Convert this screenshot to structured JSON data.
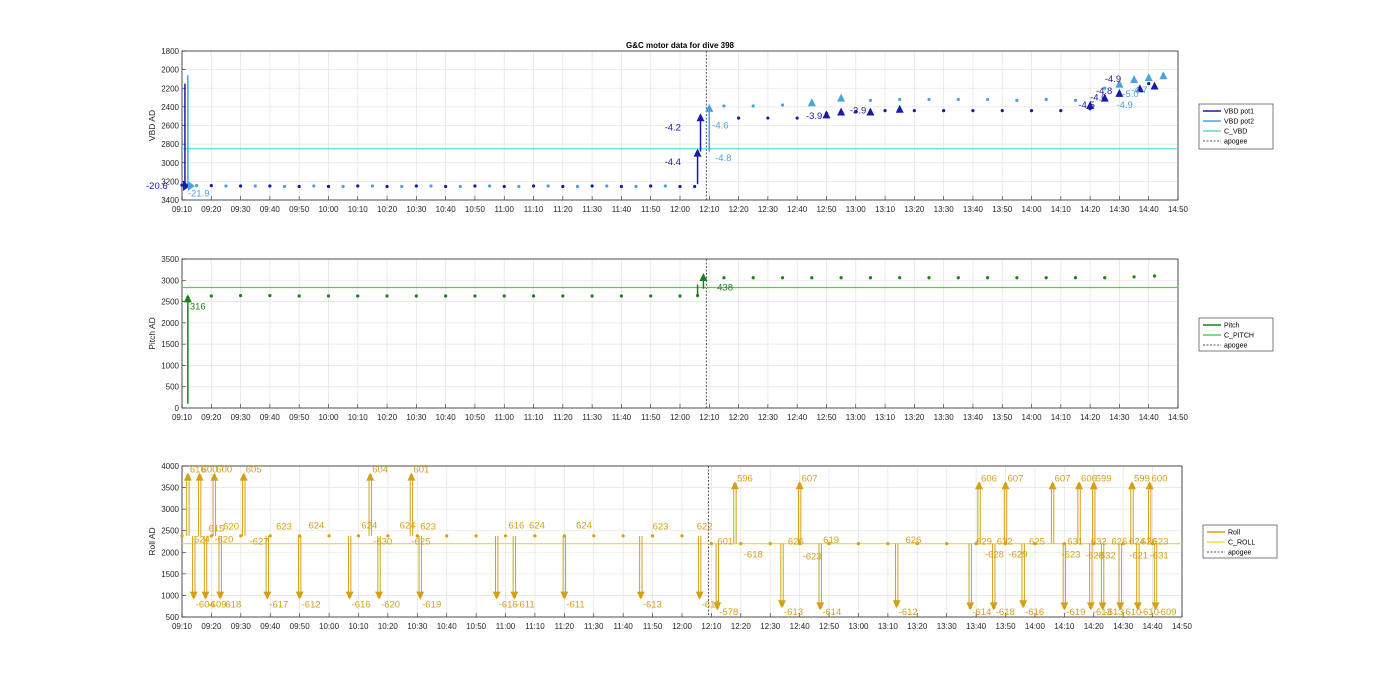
{
  "chart_data": [
    {
      "type": "scatter",
      "title": "G&C motor data for dive 398",
      "ylabel": "VBD AD",
      "ylim": [
        3400,
        1800
      ],
      "y_reversed": true,
      "yticks": [
        1800,
        2000,
        2200,
        2400,
        2600,
        2800,
        3000,
        3200,
        3400
      ],
      "xlim": [
        "09:10",
        "14:50"
      ],
      "xticks": [
        "09:10",
        "09:20",
        "09:30",
        "09:40",
        "09:50",
        "10:00",
        "10:10",
        "10:20",
        "10:30",
        "10:40",
        "10:50",
        "11:00",
        "11:10",
        "11:20",
        "11:30",
        "11:40",
        "11:50",
        "12:00",
        "12:10",
        "12:20",
        "12:30",
        "12:40",
        "12:50",
        "13:00",
        "13:10",
        "13:20",
        "13:30",
        "13:40",
        "13:50",
        "14:00",
        "14:10",
        "14:20",
        "14:30",
        "14:40",
        "14:50"
      ],
      "grid": true,
      "legend": {
        "position": "right",
        "entries": [
          "VBD pot1",
          "VBD pot2",
          "C_VBD",
          "apogee"
        ]
      },
      "colors": {
        "VBD pot1": "#1a1aa6",
        "VBD pot2": "#4aa3df",
        "C_VBD": "#5fd7e0",
        "apogee": "#555555"
      },
      "c_vbd": 2850,
      "apogee": "12:09",
      "series": [
        {
          "name": "VBD pot1",
          "x": [
            "09:10",
            "09:20",
            "09:30",
            "09:40",
            "09:50",
            "10:00",
            "10:10",
            "10:20",
            "10:30",
            "10:40",
            "10:50",
            "11:00",
            "11:10",
            "11:20",
            "11:30",
            "11:40",
            "11:50",
            "12:00",
            "12:05",
            "12:20",
            "12:30",
            "12:40",
            "12:50",
            "13:00",
            "13:10",
            "13:20",
            "13:30",
            "13:40",
            "13:50",
            "14:00",
            "14:10",
            "14:20",
            "14:30",
            "14:40"
          ],
          "y": [
            3240,
            3245,
            3250,
            3250,
            3255,
            3255,
            3250,
            3255,
            3250,
            3255,
            3250,
            3255,
            3250,
            3255,
            3250,
            3255,
            3250,
            3255,
            3255,
            2520,
            2520,
            2520,
            2470,
            2450,
            2440,
            2440,
            2440,
            2440,
            2440,
            2440,
            2440,
            2420,
            2250,
            2150
          ]
        },
        {
          "name": "VBD pot2",
          "x": [
            "09:15",
            "09:25",
            "09:35",
            "09:45",
            "09:55",
            "10:05",
            "10:15",
            "10:25",
            "10:35",
            "10:45",
            "10:55",
            "11:05",
            "11:15",
            "11:25",
            "11:35",
            "11:45",
            "11:55",
            "12:15",
            "12:25",
            "12:35",
            "12:45",
            "12:55",
            "13:05",
            "13:15",
            "13:25",
            "13:35",
            "13:45",
            "13:55",
            "14:05",
            "14:15",
            "14:25",
            "14:35",
            "14:45"
          ],
          "y": [
            3245,
            3250,
            3250,
            3255,
            3250,
            3255,
            3250,
            3255,
            3250,
            3255,
            3250,
            3255,
            3250,
            3255,
            3250,
            3255,
            3250,
            2390,
            2390,
            2380,
            2350,
            2320,
            2330,
            2320,
            2320,
            2320,
            2320,
            2330,
            2320,
            2330,
            2200,
            2100,
            2060
          ]
        }
      ],
      "annotations": [
        {
          "x": "09:10",
          "y": 3250,
          "text": "-20.6"
        },
        {
          "x": "09:12",
          "y": 3330,
          "text": "-21.9"
        },
        {
          "x": "12:06",
          "y": 2990,
          "text": "-4.4"
        },
        {
          "x": "12:06",
          "y": 2620,
          "text": "-4.2"
        },
        {
          "x": "12:11",
          "y": 2600,
          "text": "-4.6"
        },
        {
          "x": "12:12",
          "y": 2950,
          "text": "-4.8"
        },
        {
          "x": "12:43",
          "y": 2500,
          "text": "-3.9"
        },
        {
          "x": "12:58",
          "y": 2440,
          "text": "-3.9"
        },
        {
          "x": "14:16",
          "y": 2380,
          "text": "-4.5"
        },
        {
          "x": "14:20",
          "y": 2300,
          "text": "-4.0"
        },
        {
          "x": "14:22",
          "y": 2230,
          "text": "-4.8"
        },
        {
          "x": "14:25",
          "y": 2100,
          "text": "-4.9"
        },
        {
          "x": "14:29",
          "y": 2380,
          "text": "-4.9"
        },
        {
          "x": "14:31",
          "y": 2260,
          "text": "-5.0"
        },
        {
          "x": "14:34",
          "y": 2220,
          "text": "-4.7"
        }
      ]
    },
    {
      "type": "scatter",
      "ylabel": "Pitch AD",
      "ylim": [
        0,
        3500
      ],
      "yticks": [
        0,
        500,
        1000,
        1500,
        2000,
        2500,
        3000,
        3500
      ],
      "xlim": [
        "09:10",
        "14:50"
      ],
      "xticks": [
        "09:10",
        "09:20",
        "09:30",
        "09:40",
        "09:50",
        "10:00",
        "10:10",
        "10:20",
        "10:30",
        "10:40",
        "10:50",
        "11:00",
        "11:10",
        "11:20",
        "11:30",
        "11:40",
        "11:50",
        "12:00",
        "12:10",
        "12:20",
        "12:30",
        "12:40",
        "12:50",
        "13:00",
        "13:10",
        "13:20",
        "13:30",
        "13:40",
        "13:50",
        "14:00",
        "14:10",
        "14:20",
        "14:30",
        "14:40",
        "14:50"
      ],
      "grid": true,
      "legend": {
        "position": "right",
        "entries": [
          "Pitch",
          "C_PITCH",
          "apogee"
        ]
      },
      "colors": {
        "Pitch": "#1e7d1e",
        "C_PITCH": "#4dd24d",
        "apogee": "#555555"
      },
      "c_pitch": 2830,
      "apogee": "12:09",
      "series": [
        {
          "name": "Pitch",
          "x": [
            "09:12",
            "09:20",
            "09:30",
            "09:40",
            "09:50",
            "10:00",
            "10:10",
            "10:20",
            "10:30",
            "10:40",
            "10:50",
            "11:00",
            "11:10",
            "11:20",
            "11:30",
            "11:40",
            "11:50",
            "12:00",
            "12:06",
            "12:15",
            "12:25",
            "12:35",
            "12:45",
            "12:55",
            "13:05",
            "13:15",
            "13:25",
            "13:35",
            "13:45",
            "13:55",
            "14:05",
            "14:15",
            "14:25",
            "14:35",
            "14:42"
          ],
          "y": [
            2600,
            2630,
            2640,
            2640,
            2630,
            2630,
            2630,
            2630,
            2630,
            2630,
            2630,
            2630,
            2630,
            2630,
            2630,
            2630,
            2630,
            2630,
            2640,
            3060,
            3060,
            3060,
            3060,
            3060,
            3060,
            3060,
            3060,
            3060,
            3060,
            3060,
            3060,
            3060,
            3060,
            3080,
            3100
          ]
        }
      ],
      "annotations": [
        {
          "x": "09:12",
          "y": 2380,
          "text": "316"
        },
        {
          "x": "12:12",
          "y": 2830,
          "text": "438"
        }
      ]
    },
    {
      "type": "scatter",
      "ylabel": "Roll AD",
      "ylim": [
        500,
        4000
      ],
      "yticks": [
        500,
        1000,
        1500,
        2000,
        2500,
        3000,
        3500,
        4000
      ],
      "xlim": [
        "09:10",
        "14:50"
      ],
      "xticks": [
        "09:10",
        "09:20",
        "09:30",
        "09:40",
        "09:50",
        "10:00",
        "10:10",
        "10:20",
        "10:30",
        "10:40",
        "10:50",
        "11:00",
        "11:10",
        "11:20",
        "11:30",
        "11:40",
        "11:50",
        "12:00",
        "12:10",
        "12:20",
        "12:30",
        "12:40",
        "12:50",
        "13:00",
        "13:10",
        "13:20",
        "13:30",
        "13:40",
        "13:50",
        "14:00",
        "14:10",
        "14:20",
        "14:30",
        "14:40",
        "14:50"
      ],
      "grid": true,
      "legend": {
        "position": "right",
        "entries": [
          "Roll",
          "C_ROLL",
          "apogee"
        ]
      },
      "colors": {
        "Roll": "#d4a017",
        "C_ROLL": "#f0e02a",
        "apogee": "#555555"
      },
      "c_roll": 2200,
      "apogee": "12:09",
      "roll_base_before": 2380,
      "roll_base_after": 2200,
      "series": [
        {
          "name": "Roll",
          "x": [
            "09:10",
            "09:20",
            "09:30",
            "09:40",
            "09:50",
            "10:00",
            "10:10",
            "10:20",
            "10:30",
            "10:40",
            "10:50",
            "11:00",
            "11:10",
            "11:20",
            "11:30",
            "11:40",
            "11:50",
            "12:00",
            "12:10",
            "12:20",
            "12:30",
            "12:40",
            "12:50",
            "13:00",
            "13:10",
            "13:20",
            "13:30",
            "13:40",
            "13:50",
            "14:00",
            "14:10",
            "14:20",
            "14:30",
            "14:40"
          ],
          "y": [
            2380,
            2380,
            2380,
            2380,
            2380,
            2380,
            2380,
            2380,
            2380,
            2380,
            2380,
            2380,
            2380,
            2380,
            2380,
            2380,
            2380,
            2380,
            2200,
            2200,
            2200,
            2200,
            2200,
            2200,
            2200,
            2200,
            2200,
            2200,
            2200,
            2200,
            2200,
            2200,
            2200,
            2200
          ]
        }
      ],
      "arrows": [
        {
          "x": "09:12",
          "dir": "up",
          "y": 3800,
          "text": "616"
        },
        {
          "x": "09:14",
          "dir": "down",
          "y": 950,
          "text": "-604"
        },
        {
          "x": "09:16",
          "dir": "up",
          "y": 3800,
          "text": "600"
        },
        {
          "x": "09:18",
          "dir": "down",
          "y": 950,
          "text": "-609"
        },
        {
          "x": "09:21",
          "dir": "up",
          "y": 3800,
          "text": "600"
        },
        {
          "x": "09:23",
          "dir": "down",
          "y": 950,
          "text": "-618"
        },
        {
          "x": "09:31",
          "dir": "up",
          "y": 3800,
          "text": "605"
        },
        {
          "x": "09:39",
          "dir": "down",
          "y": 950,
          "text": "-617"
        },
        {
          "x": "09:50",
          "dir": "down",
          "y": 950,
          "text": "-612"
        },
        {
          "x": "10:07",
          "dir": "down",
          "y": 950,
          "text": "-616"
        },
        {
          "x": "10:14",
          "dir": "up",
          "y": 3800,
          "text": "604"
        },
        {
          "x": "10:17",
          "dir": "down",
          "y": 950,
          "text": "-620"
        },
        {
          "x": "10:28",
          "dir": "up",
          "y": 3800,
          "text": "601"
        },
        {
          "x": "10:31",
          "dir": "down",
          "y": 950,
          "text": "-619"
        },
        {
          "x": "10:57",
          "dir": "down",
          "y": 950,
          "text": "-616"
        },
        {
          "x": "11:03",
          "dir": "down",
          "y": 950,
          "text": "-611"
        },
        {
          "x": "11:20",
          "dir": "down",
          "y": 950,
          "text": "-611"
        },
        {
          "x": "11:46",
          "dir": "down",
          "y": 950,
          "text": "-613"
        },
        {
          "x": "12:06",
          "dir": "down",
          "y": 950,
          "text": "-611"
        },
        {
          "x": "12:12",
          "dir": "down",
          "y": 700,
          "text": "-578"
        },
        {
          "x": "12:18",
          "dir": "up",
          "y": 3600,
          "text": "596"
        },
        {
          "x": "12:34",
          "dir": "down",
          "y": 750,
          "text": "-613"
        },
        {
          "x": "12:40",
          "dir": "up",
          "y": 3600,
          "text": "607"
        },
        {
          "x": "12:47",
          "dir": "down",
          "y": 700,
          "text": "-614"
        },
        {
          "x": "13:13",
          "dir": "down",
          "y": 750,
          "text": "-612"
        },
        {
          "x": "13:38",
          "dir": "down",
          "y": 700,
          "text": "-614"
        },
        {
          "x": "13:41",
          "dir": "up",
          "y": 3600,
          "text": "606"
        },
        {
          "x": "13:46",
          "dir": "down",
          "y": 700,
          "text": "-618"
        },
        {
          "x": "13:50",
          "dir": "up",
          "y": 3600,
          "text": "607"
        },
        {
          "x": "13:56",
          "dir": "down",
          "y": 750,
          "text": "-616"
        },
        {
          "x": "14:06",
          "dir": "up",
          "y": 3600,
          "text": "607"
        },
        {
          "x": "14:10",
          "dir": "down",
          "y": 700,
          "text": "-619"
        },
        {
          "x": "14:15",
          "dir": "up",
          "y": 3600,
          "text": "606"
        },
        {
          "x": "14:20",
          "dir": "up",
          "y": 3600,
          "text": "599"
        },
        {
          "x": "14:19",
          "dir": "down",
          "y": 700,
          "text": "-613"
        },
        {
          "x": "14:23",
          "dir": "down",
          "y": 700,
          "text": "-613"
        },
        {
          "x": "14:29",
          "dir": "down",
          "y": 700,
          "text": "-610"
        },
        {
          "x": "14:33",
          "dir": "up",
          "y": 3600,
          "text": "599"
        },
        {
          "x": "14:35",
          "dir": "down",
          "y": 700,
          "text": "-610"
        },
        {
          "x": "14:39",
          "dir": "up",
          "y": 3600,
          "text": "600"
        },
        {
          "x": "14:41",
          "dir": "down",
          "y": 700,
          "text": "-609"
        }
      ],
      "labels": [
        {
          "x": "09:13",
          "y": 2300,
          "text": "-624"
        },
        {
          "x": "09:19",
          "y": 2550,
          "text": "615"
        },
        {
          "x": "09:21",
          "y": 2300,
          "text": "-620"
        },
        {
          "x": "09:24",
          "y": 2600,
          "text": "620"
        },
        {
          "x": "09:33",
          "y": 2250,
          "text": "-627"
        },
        {
          "x": "09:42",
          "y": 2600,
          "text": "623"
        },
        {
          "x": "09:53",
          "y": 2620,
          "text": "624"
        },
        {
          "x": "10:11",
          "y": 2620,
          "text": "624"
        },
        {
          "x": "10:15",
          "y": 2250,
          "text": "-630"
        },
        {
          "x": "10:24",
          "y": 2620,
          "text": "624"
        },
        {
          "x": "10:31",
          "y": 2600,
          "text": "623"
        },
        {
          "x": "10:28",
          "y": 2250,
          "text": "-625"
        },
        {
          "x": "11:01",
          "y": 2620,
          "text": "616"
        },
        {
          "x": "11:08",
          "y": 2620,
          "text": "624"
        },
        {
          "x": "11:24",
          "y": 2620,
          "text": "624"
        },
        {
          "x": "11:50",
          "y": 2600,
          "text": "623"
        },
        {
          "x": "12:05",
          "y": 2600,
          "text": "622"
        },
        {
          "x": "12:12",
          "y": 2250,
          "text": "601"
        },
        {
          "x": "12:21",
          "y": 1950,
          "text": "-618"
        },
        {
          "x": "12:36",
          "y": 2250,
          "text": "626"
        },
        {
          "x": "12:41",
          "y": 1900,
          "text": "-623"
        },
        {
          "x": "12:48",
          "y": 2280,
          "text": "619"
        },
        {
          "x": "13:16",
          "y": 2280,
          "text": "626"
        },
        {
          "x": "13:40",
          "y": 2250,
          "text": "629"
        },
        {
          "x": "13:43",
          "y": 1950,
          "text": "-628"
        },
        {
          "x": "13:47",
          "y": 2250,
          "text": "632"
        },
        {
          "x": "13:51",
          "y": 1950,
          "text": "-629"
        },
        {
          "x": "13:58",
          "y": 2250,
          "text": "625"
        },
        {
          "x": "14:09",
          "y": 1950,
          "text": "-623"
        },
        {
          "x": "14:11",
          "y": 2250,
          "text": "631"
        },
        {
          "x": "14:17",
          "y": 1920,
          "text": "-628"
        },
        {
          "x": "14:19",
          "y": 2250,
          "text": "632"
        },
        {
          "x": "14:21",
          "y": 1920,
          "text": "-632"
        },
        {
          "x": "14:26",
          "y": 2250,
          "text": "626"
        },
        {
          "x": "14:32",
          "y": 2250,
          "text": "624"
        },
        {
          "x": "14:32",
          "y": 1920,
          "text": "-621"
        },
        {
          "x": "14:36",
          "y": 2250,
          "text": "626"
        },
        {
          "x": "14:39",
          "y": 1920,
          "text": "-631"
        },
        {
          "x": "14:40",
          "y": 2250,
          "text": "623"
        }
      ]
    }
  ]
}
